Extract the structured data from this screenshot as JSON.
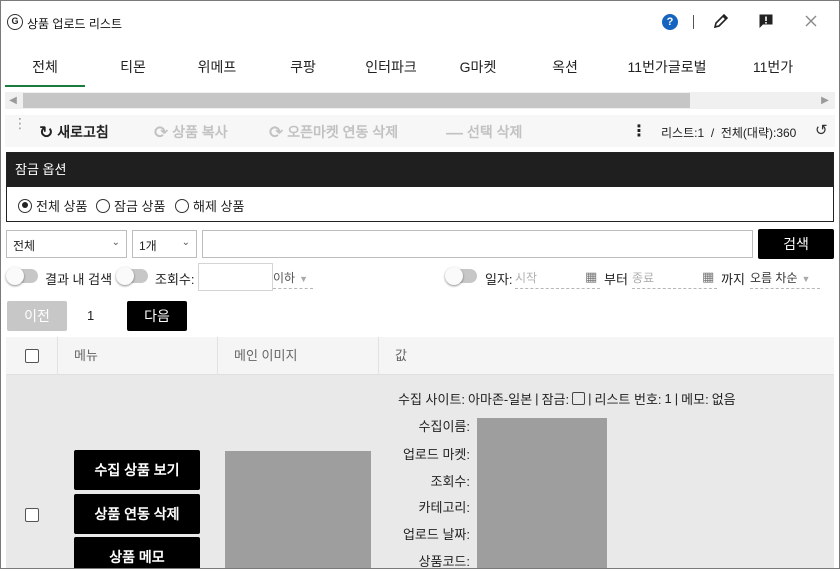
{
  "window": {
    "logo_glyph": "G",
    "title": "상품 업로드 리스트",
    "help_glyph": "?",
    "icons": [
      "help-icon",
      "edit-icon",
      "report-icon",
      "close-icon"
    ]
  },
  "tabs": [
    {
      "label": "전체",
      "active": true
    },
    {
      "label": "티몬"
    },
    {
      "label": "위메프"
    },
    {
      "label": "쿠팡"
    },
    {
      "label": "인터파크"
    },
    {
      "label": "G마켓"
    },
    {
      "label": "옥션"
    },
    {
      "label": "11번가글로벌"
    },
    {
      "label": "11번가"
    }
  ],
  "toolbar": {
    "refresh": "새로고침",
    "copy_product": "상품 복사",
    "delete_openmarket_link": "오픈마켓 연동 삭제",
    "delete_selected": "선택 삭제",
    "list_label": "리스트:1",
    "total_label": "전체(대략):360",
    "separator": "/"
  },
  "lock_options": {
    "title": "잠금 옵션",
    "options": [
      "전체 상품",
      "잠금 상품",
      "해제 상품"
    ],
    "selected": "전체 상품"
  },
  "search": {
    "category_value": "전체",
    "count_value": "1개",
    "query_value": "",
    "button": "검색"
  },
  "filters": {
    "search_in_results": "결과 내 검색",
    "views_label": "조회수:",
    "views_value": "",
    "views_cond": "이하",
    "date_label": "일자:",
    "start_placeholder": "시작",
    "from_label": "부터",
    "end_placeholder": "종료",
    "until_label": "까지",
    "sort_value": "오름 차순"
  },
  "pager": {
    "prev": "이전",
    "page": "1",
    "next": "다음"
  },
  "table": {
    "headers": [
      "메뉴",
      "메인 이미지",
      "값"
    ],
    "row": {
      "actions": [
        "수집 상품 보기",
        "상품 연동 삭제",
        "상품 메모"
      ],
      "site_label": "수집 사이트:",
      "site_value": "아마존-일본",
      "lock_label": "잠금:",
      "list_no_label": "리스트 번호:",
      "list_no_value": "1",
      "memo_label": "메모:",
      "memo_value": "없음",
      "fields": [
        "수집이름:",
        "업로드 마켓:",
        "조회수:",
        "카테고리:",
        "업로드 날짜:",
        "상품코드:"
      ]
    }
  }
}
